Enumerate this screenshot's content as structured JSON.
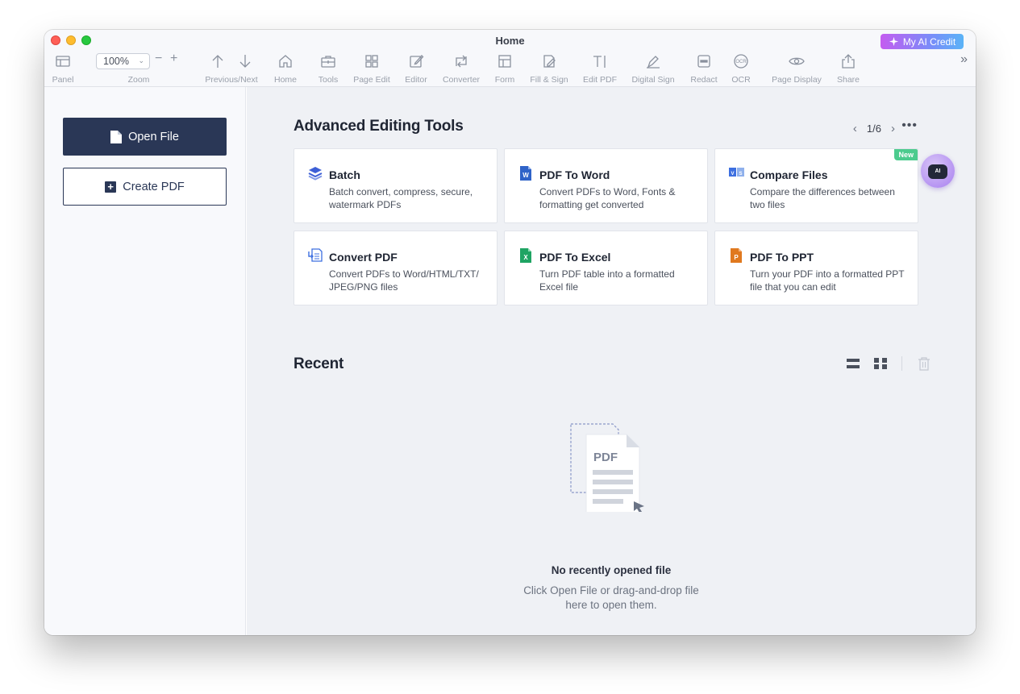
{
  "window": {
    "title": "Home",
    "ai_credit_label": "My AI Credit"
  },
  "toolbar": {
    "zoom_value": "100%",
    "zoom_minus": "−",
    "zoom_plus": "+",
    "more_icon": "»",
    "items": [
      {
        "label": "Panel",
        "icon": "panel-icon"
      },
      {
        "label": "Zoom",
        "icon": "zoom-icon"
      },
      {
        "label": "Previous/Next",
        "icon": "arrows-icon"
      },
      {
        "label": "Home",
        "icon": "home-icon"
      },
      {
        "label": "Tools",
        "icon": "toolbox-icon"
      },
      {
        "label": "Page Edit",
        "icon": "grid-icon"
      },
      {
        "label": "Editor",
        "icon": "edit-icon"
      },
      {
        "label": "Converter",
        "icon": "convert-icon"
      },
      {
        "label": "Form",
        "icon": "form-icon"
      },
      {
        "label": "Fill & Sign",
        "icon": "fill-sign-icon"
      },
      {
        "label": "Edit PDF",
        "icon": "text-cursor-icon"
      },
      {
        "label": "Digital Sign",
        "icon": "pen-icon"
      },
      {
        "label": "Redact",
        "icon": "redact-icon"
      },
      {
        "label": "OCR",
        "icon": "ocr-icon"
      },
      {
        "label": "Page Display",
        "icon": "eye-icon"
      },
      {
        "label": "Share",
        "icon": "share-icon"
      }
    ]
  },
  "sidebar": {
    "open_file": "Open File",
    "create_pdf": "Create PDF",
    "create_pdf_icon": "+"
  },
  "tools_section": {
    "title": "Advanced Editing Tools",
    "page_indicator": "1/6",
    "prev": "‹",
    "next": "›",
    "more": "•••",
    "cards": [
      {
        "title": "Batch",
        "desc": "Batch convert, compress, secure, watermark PDFs",
        "icon": "layers-icon",
        "color": "#3d5fd6"
      },
      {
        "title": "PDF To Word",
        "desc": "Convert PDFs to Word, Fonts & formatting get converted",
        "icon": "word-icon",
        "color": "#2f63c8",
        "glyph": "W"
      },
      {
        "title": "Compare Files",
        "desc": "Compare the differences between two files",
        "icon": "compare-icon",
        "color": "#3d6fe0",
        "badge": "New",
        "glyph": "V S"
      },
      {
        "title": "Convert PDF",
        "desc": "Convert PDFs to Word/HTML/TXT/ JPEG/PNG files",
        "icon": "convert-pdf-icon",
        "color": "#3d6fe0"
      },
      {
        "title": "PDF To Excel",
        "desc": "Turn PDF table into a formatted Excel file",
        "icon": "excel-icon",
        "color": "#1fa463",
        "glyph": "X"
      },
      {
        "title": "PDF To PPT",
        "desc": "Turn your PDF into a formatted PPT file that you can edit",
        "icon": "ppt-icon",
        "color": "#e0791f",
        "glyph": "P"
      }
    ]
  },
  "ai_assistant": {
    "label": "AI"
  },
  "recent_section": {
    "title": "Recent",
    "empty_illustration_text": "PDF",
    "empty_title": "No recently opened file",
    "empty_line1": "Click Open File or drag-and-drop file",
    "empty_line2": "here to open them."
  }
}
